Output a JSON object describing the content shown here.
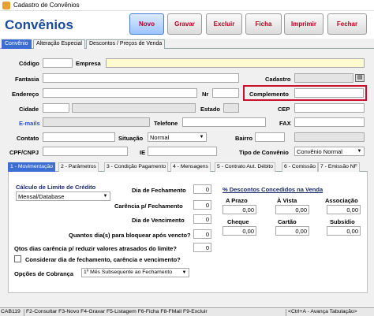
{
  "window": {
    "title": "Cadastro de Convênios"
  },
  "header": {
    "page_title": "Convênios"
  },
  "toolbar": {
    "novo": "Novo",
    "gravar": "Gravar",
    "excluir": "Excluir",
    "ficha": "Ficha",
    "imprimir": "Imprimir",
    "fechar": "Fechar"
  },
  "top_tabs": [
    "Convênio",
    "Alteração Especial",
    "Descontos / Preços de Venda"
  ],
  "form": {
    "codigo_label": "Código",
    "empresa_label": "Empresa",
    "fantasia_label": "Fantasia",
    "cadastro_label": "Cadastro",
    "endereco_label": "Endereço",
    "nr_label": "Nr",
    "complemento_label": "Complemento",
    "cidade_label": "Cidade",
    "estado_label": "Estado",
    "cep_label": "CEP",
    "emails_label": "E-mails",
    "telefone_label": "Telefone",
    "fax_label": "FAX",
    "contato_label": "Contato",
    "situacao_label": "Situação",
    "situacao_value": "Normal",
    "bairro_label": "Bairro",
    "cpf_label": "CPF/CNPJ",
    "ie_label": "IE",
    "tipo_label": "Tipo de Convênio",
    "tipo_value": "Convênio Normal"
  },
  "bottom_tabs": [
    "1 - Movimentação",
    "2 - Parâmetros",
    "3 - Condição Pagamento",
    "4 - Mensagens",
    "5 - Contrato Aut. Débito",
    "6 - Comissão",
    "7 - Emissão NF"
  ],
  "panel": {
    "calc_label": "Cálculo de Limite de Crédito",
    "calc_value": "Mensal/Database",
    "dia_fechamento_label": "Dia de Fechamento",
    "dia_fechamento_value": "0",
    "carencia_label": "Carência p/ Fechamento",
    "carencia_value": "0",
    "dia_vencimento_label": "Dia de Vencimento",
    "dia_vencimento_value": "0",
    "quantos_dias_label": "Quantos dia(s) para bloquear após vencto?",
    "quantos_dias_value": "0",
    "qtos_dias_label": "Qtos dias carência p/ reduzir valores atrasados do limite?",
    "qtos_dias_value": "0",
    "considerar_label": "Considerar dia de fechamento, carência e vencimento?",
    "opcoes_label": "Opções de Cobrança",
    "opcoes_value": "1º Mês Subsequente ao Fechamento",
    "descontos_title": "% Descontos Concedidos na Venda",
    "a_prazo_label": "A Prazo",
    "a_prazo_value": "0,00",
    "a_vista_label": "À Vista",
    "a_vista_value": "0,00",
    "associacao_label": "Associação",
    "associacao_value": "0,00",
    "cheque_label": "Cheque",
    "cheque_value": "0,00",
    "cartao_label": "Cartão",
    "cartao_value": "0,00",
    "subsidio_label": "Subsídio",
    "subsidio_value": "0,00"
  },
  "statusbar": {
    "code": "CAB119",
    "shortcuts": "F2-Consultar  F3-Novo  F4-Gravar  F5-Listagem  F6-Ficha  F8-FMail  F9-Excluir",
    "hint": "<Ctrl+A - Avança Tabulação>"
  }
}
